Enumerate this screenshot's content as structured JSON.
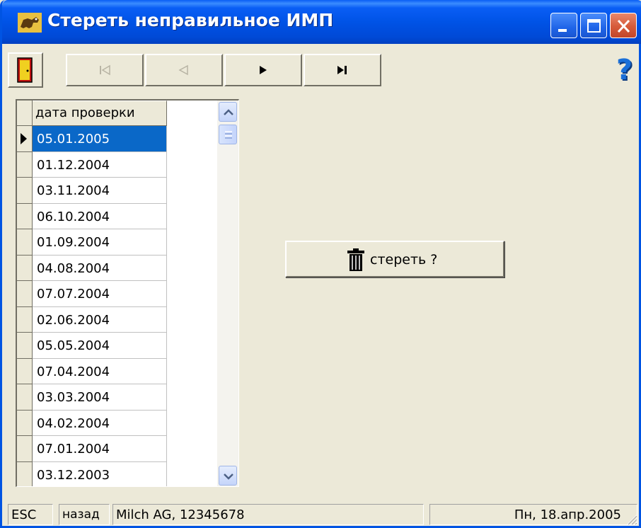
{
  "window": {
    "title": "Стереть неправильное ИМП"
  },
  "toolbar": {
    "buttons": [
      "exit",
      "first",
      "prior",
      "next",
      "last",
      "help"
    ],
    "help_label": "?"
  },
  "grid": {
    "column_header": "дата проверки",
    "selected_index": 0,
    "rows": [
      "05.01.2005",
      "01.12.2004",
      "03.11.2004",
      "06.10.2004",
      "01.09.2004",
      "04.08.2004",
      "07.07.2004",
      "02.06.2004",
      "05.05.2004",
      "07.04.2004",
      "03.03.2004",
      "04.02.2004",
      "07.01.2004",
      "03.12.2003"
    ]
  },
  "delete_button": {
    "label": "стереть ?",
    "icon": "trash-icon"
  },
  "statusbar": {
    "esc": "ESC",
    "back": "назад",
    "info": "Milch AG, 12345678",
    "date": "Пн, 18.апр.2005"
  },
  "colors": {
    "titlebar": "#0053e6",
    "selection": "#0a68c8",
    "window_bg": "#ece9d8",
    "help_icon": "#1a6fd8"
  }
}
